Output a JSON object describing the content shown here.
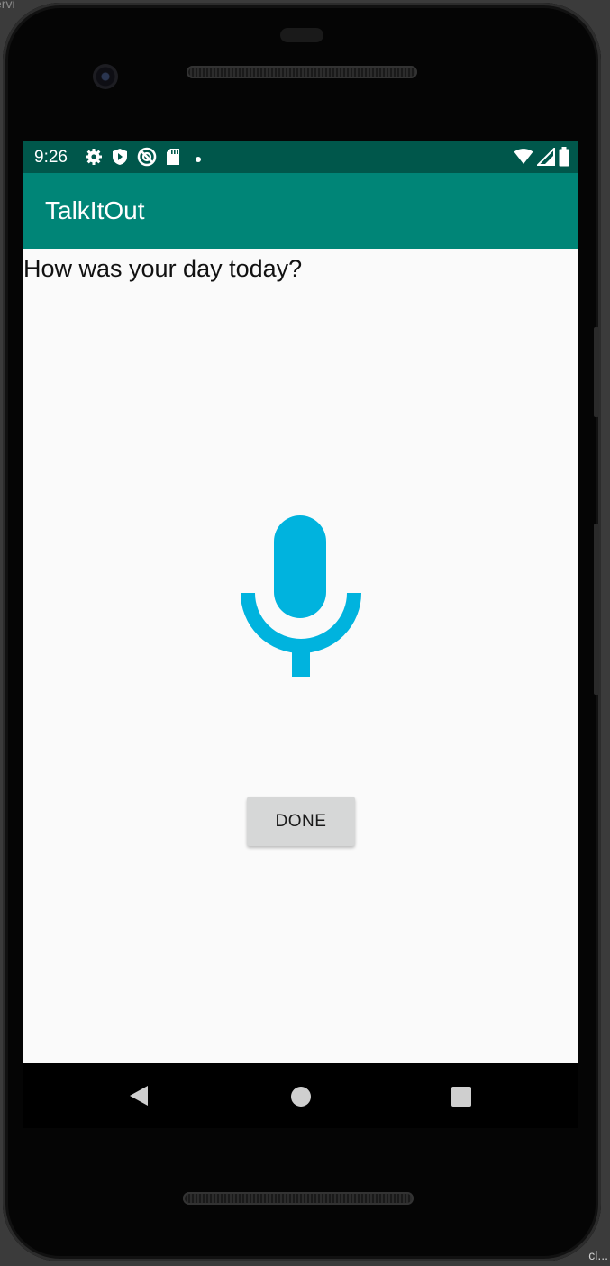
{
  "window": {
    "corner_text": "ervi",
    "corner_text_br": "cl..."
  },
  "status_bar": {
    "time": "9:26",
    "left_icons": [
      "settings-icon",
      "shield-icon",
      "no-sync-icon",
      "sd-card-icon",
      "dot-icon"
    ],
    "right_icons": [
      "wifi-icon",
      "cellular-icon",
      "battery-icon"
    ],
    "background": "#00574b"
  },
  "app_bar": {
    "title": "TalkItOut",
    "background": "#008577"
  },
  "content": {
    "prompt": "How was your day today?",
    "mic_icon": "microphone-icon",
    "mic_color": "#00b3de",
    "done_label": "DONE"
  },
  "nav_bar": {
    "buttons": [
      "back-icon",
      "home-icon",
      "recents-icon"
    ]
  }
}
